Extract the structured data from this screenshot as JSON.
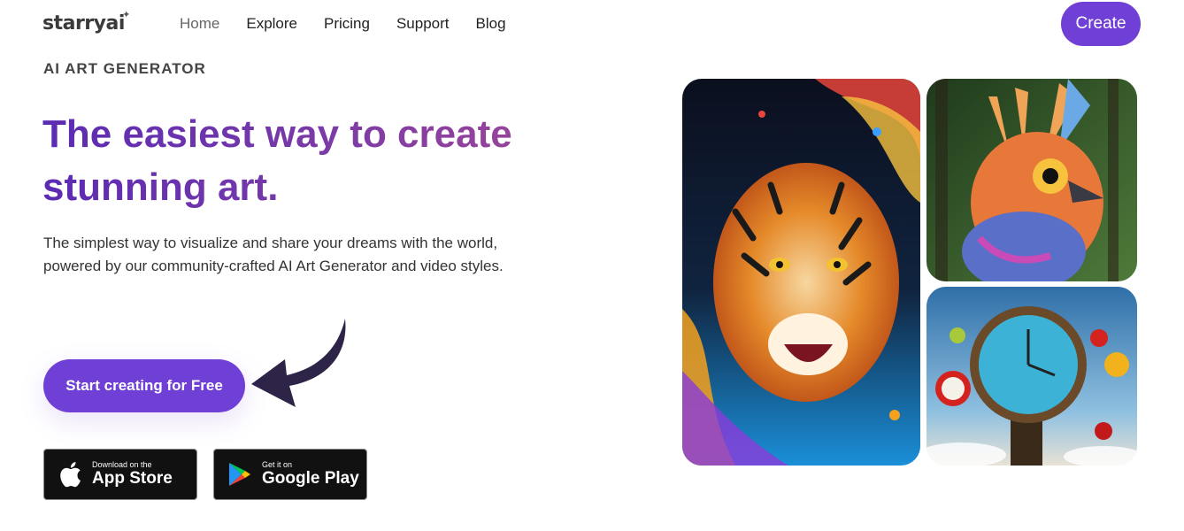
{
  "brand": {
    "name": "starryai"
  },
  "nav": {
    "items": [
      {
        "label": "Home"
      },
      {
        "label": "Explore"
      },
      {
        "label": "Pricing"
      },
      {
        "label": "Support"
      },
      {
        "label": "Blog"
      }
    ],
    "create_label": "Create"
  },
  "hero": {
    "eyebrow": "AI ART GENERATOR",
    "headline": "The easiest way to create stunning art.",
    "description": "The simplest way to visualize and share your dreams with the world, powered by our community-crafted AI Art Generator and video styles.",
    "cta_label": "Start creating for Free"
  },
  "stores": {
    "apple": {
      "small": "Download on the",
      "big": "App Store"
    },
    "google": {
      "small": "Get it on",
      "big": "Google Play"
    }
  },
  "colors": {
    "accent": "#6f3fd6",
    "headline_start": "#5b2bb3",
    "headline_end": "#a24794"
  },
  "gallery": [
    {
      "icon": "tiger-artwork"
    },
    {
      "icon": "bird-artwork"
    },
    {
      "icon": "clock-artwork"
    }
  ]
}
